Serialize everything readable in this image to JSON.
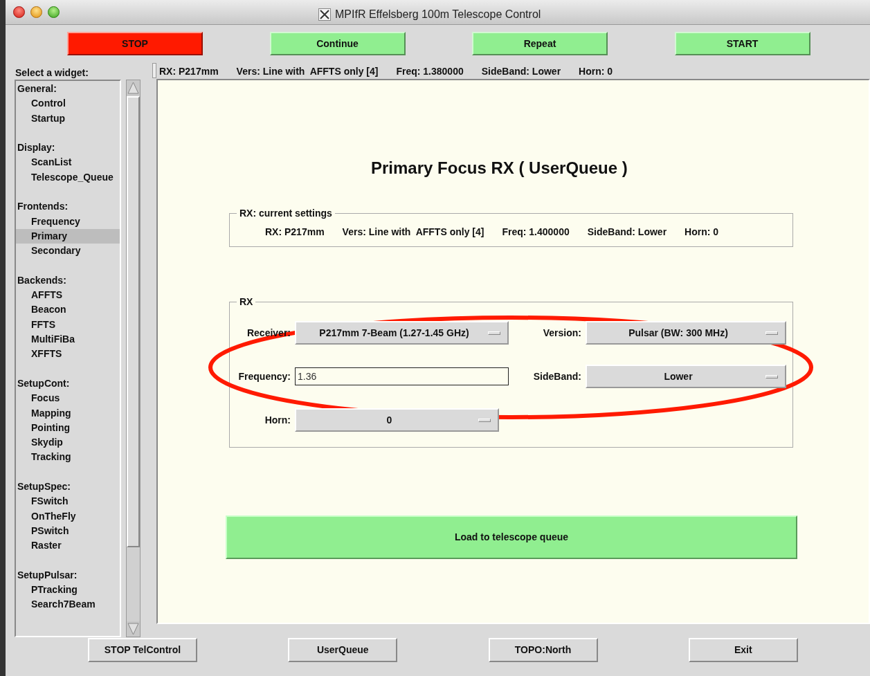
{
  "window": {
    "title": "MPIfR Effelsberg 100m Telescope Control"
  },
  "top_buttons": [
    {
      "label": "STOP",
      "color": "#ff1a00"
    },
    {
      "label": "Continue",
      "color": "#90ee90"
    },
    {
      "label": "Repeat",
      "color": "#90ee90"
    },
    {
      "label": "START",
      "color": "#90ee90"
    }
  ],
  "sidebar": {
    "title": "Select a widget:",
    "groups": [
      {
        "label": "General:",
        "children": [
          {
            "label": "Control",
            "selected": false
          },
          {
            "label": "Startup",
            "selected": false
          }
        ]
      },
      {
        "label": "Display:",
        "children": [
          {
            "label": "ScanList",
            "selected": false
          },
          {
            "label": "Telescope_Queue",
            "selected": false
          }
        ]
      },
      {
        "label": "Frontends:",
        "children": [
          {
            "label": "Frequency",
            "selected": false
          },
          {
            "label": "Primary",
            "selected": true
          },
          {
            "label": "Secondary",
            "selected": false
          }
        ]
      },
      {
        "label": "Backends:",
        "children": [
          {
            "label": "AFFTS",
            "selected": false
          },
          {
            "label": "Beacon",
            "selected": false
          },
          {
            "label": "FFTS",
            "selected": false
          },
          {
            "label": "MultiFiBa",
            "selected": false
          },
          {
            "label": "XFFTS",
            "selected": false
          }
        ]
      },
      {
        "label": "SetupCont:",
        "children": [
          {
            "label": "Focus",
            "selected": false
          },
          {
            "label": "Mapping",
            "selected": false
          },
          {
            "label": "Pointing",
            "selected": false
          },
          {
            "label": "Skydip",
            "selected": false
          },
          {
            "label": "Tracking",
            "selected": false
          }
        ]
      },
      {
        "label": "SetupSpec:",
        "children": [
          {
            "label": "FSwitch",
            "selected": false
          },
          {
            "label": "OnTheFly",
            "selected": false
          },
          {
            "label": "PSwitch",
            "selected": false
          },
          {
            "label": "Raster",
            "selected": false
          }
        ]
      },
      {
        "label": "SetupPulsar:",
        "children": [
          {
            "label": "PTracking",
            "selected": false
          },
          {
            "label": "Search7Beam",
            "selected": false
          }
        ]
      }
    ]
  },
  "status_line": [
    "RX: P217mm",
    "Vers: Line with  AFFTS only [4]",
    "Freq: 1.380000",
    "SideBand: Lower",
    "Horn: 0"
  ],
  "panel": {
    "title": "Primary Focus RX ( UserQueue )",
    "current_settings": {
      "legend": "RX: current settings",
      "values": [
        "RX: P217mm",
        "Vers: Line with  AFFTS only [4]",
        "Freq: 1.400000",
        "SideBand: Lower",
        "Horn: 0"
      ]
    },
    "rx": {
      "legend": "RX",
      "fields": [
        {
          "label": "Receiver:",
          "kind": "dropdown",
          "value": "P217mm 7-Beam (1.27-1.45 GHz)"
        },
        {
          "label": "Version:",
          "kind": "dropdown",
          "value": "Pulsar (BW: 300 MHz)"
        },
        {
          "label": "Frequency:",
          "kind": "input",
          "value": "1.36"
        },
        {
          "label": "SideBand:",
          "kind": "dropdown",
          "value": "Lower"
        },
        {
          "label": "Horn:",
          "kind": "dropdown",
          "value": "0"
        }
      ]
    },
    "load_button": "Load to telescope queue"
  },
  "bottom_buttons": [
    "STOP TelControl",
    "UserQueue",
    "TOPO:North",
    "Exit"
  ]
}
